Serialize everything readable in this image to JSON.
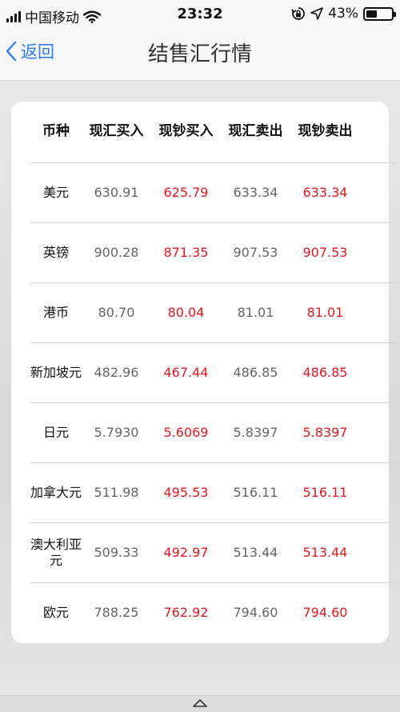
{
  "status_bar": {
    "carrier": "中国移动",
    "time": "23:32",
    "battery_percent": "43%",
    "battery_level": 0.43
  },
  "nav": {
    "back_label": "返回",
    "title": "结售汇行情"
  },
  "table": {
    "headers": [
      "币种",
      "现汇买入",
      "现钞买入",
      "现汇卖出",
      "现钞卖出"
    ],
    "rows": [
      {
        "currency": "美元",
        "v1": "630.91",
        "v2": "625.79",
        "v3": "633.34",
        "v4": "633.34"
      },
      {
        "currency": "英镑",
        "v1": "900.28",
        "v2": "871.35",
        "v3": "907.53",
        "v4": "907.53"
      },
      {
        "currency": "港币",
        "v1": "80.70",
        "v2": "80.04",
        "v3": "81.01",
        "v4": "81.01"
      },
      {
        "currency": "新加坡元",
        "v1": "482.96",
        "v2": "467.44",
        "v3": "486.85",
        "v4": "486.85"
      },
      {
        "currency": "日元",
        "v1": "5.7930",
        "v2": "5.6069",
        "v3": "5.8397",
        "v4": "5.8397"
      },
      {
        "currency": "加拿大元",
        "v1": "511.98",
        "v2": "495.53",
        "v3": "516.11",
        "v4": "516.11"
      },
      {
        "currency": "澳大利亚元",
        "v1": "509.33",
        "v2": "492.97",
        "v3": "513.44",
        "v4": "513.44"
      },
      {
        "currency": "欧元",
        "v1": "788.25",
        "v2": "762.92",
        "v3": "794.60",
        "v4": "794.60"
      }
    ]
  },
  "colors": {
    "accent": "#2d7cf6",
    "red_value": "#e8191f",
    "gray_value": "#666666"
  }
}
